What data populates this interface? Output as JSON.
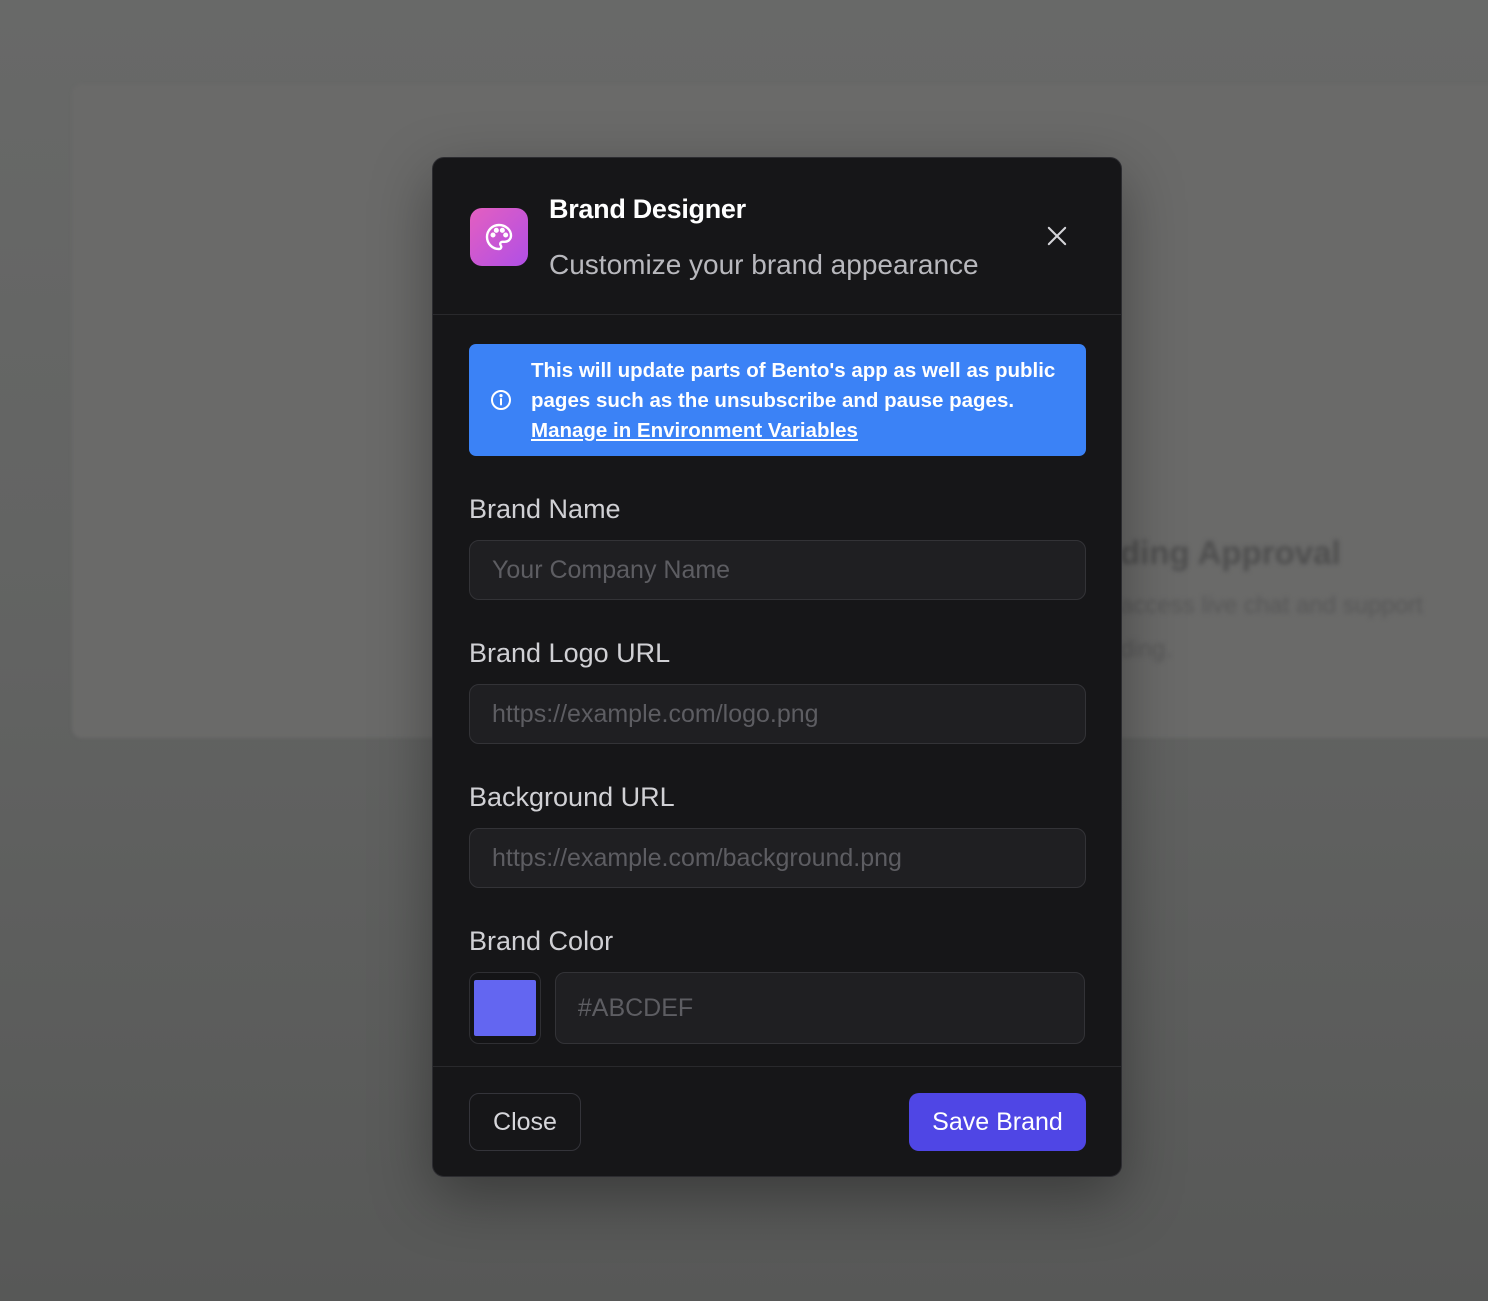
{
  "background_page": {
    "heading": "ding Approval",
    "line_1": "access live chat and support",
    "line_2": "ding."
  },
  "modal": {
    "icon": "palette-icon",
    "title": "Brand Designer",
    "subtitle": "Customize your brand appearance",
    "close_icon": "close-icon",
    "info_banner": {
      "icon": "info-circle-icon",
      "text": "This will update parts of Bento's app as well as public pages such as the unsubscribe and pause pages.",
      "link_text": "Manage in Environment Variables",
      "color": "#3b82f6"
    },
    "fields": {
      "brand_name": {
        "label": "Brand Name",
        "value": "",
        "placeholder": "Your Company Name"
      },
      "brand_logo_url": {
        "label": "Brand Logo URL",
        "value": "",
        "placeholder": "https://example.com/logo.png"
      },
      "background_url": {
        "label": "Background URL",
        "value": "",
        "placeholder": "https://example.com/background.png"
      },
      "brand_color": {
        "label": "Brand Color",
        "value": "",
        "placeholder": "#ABCDEF",
        "swatch_color": "#6366f1"
      }
    },
    "footer": {
      "close_label": "Close",
      "save_label": "Save Brand",
      "save_color": "#4f46e5"
    }
  }
}
